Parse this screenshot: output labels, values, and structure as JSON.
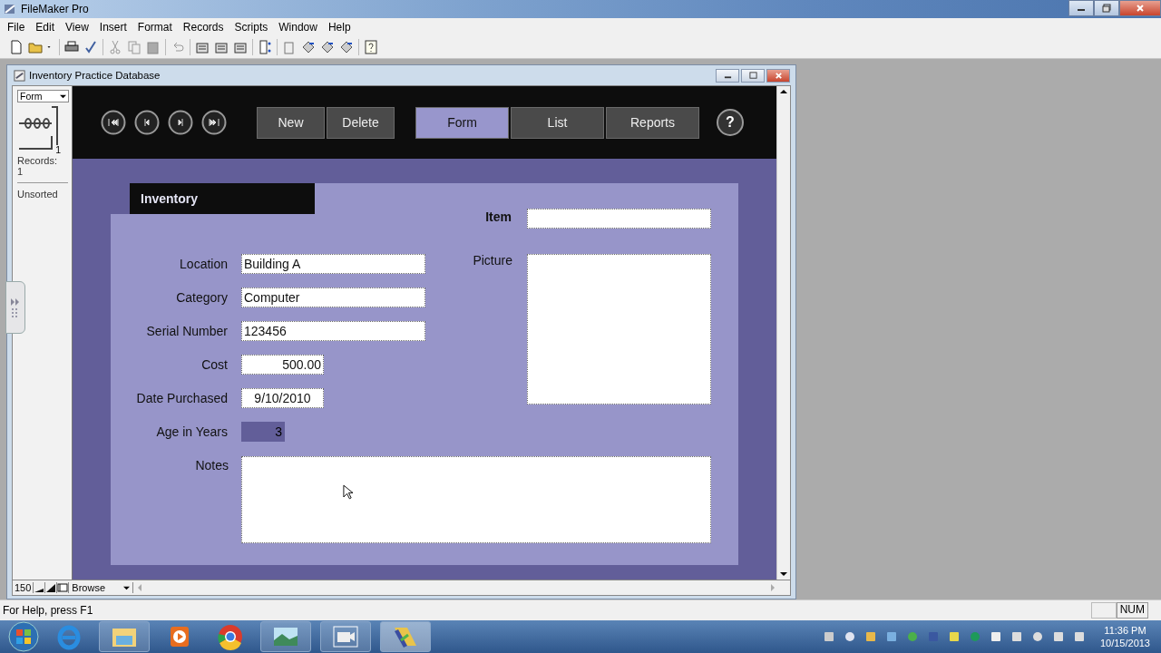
{
  "app": {
    "title": "FileMaker Pro"
  },
  "menu": [
    "File",
    "Edit",
    "View",
    "Insert",
    "Format",
    "Records",
    "Scripts",
    "Window",
    "Help"
  ],
  "window": {
    "title": "Inventory Practice Database"
  },
  "status_area": {
    "layout": "Form",
    "page": "1",
    "records_label": "Records:",
    "records_count": "1",
    "sort_status": "Unsorted"
  },
  "record_buttons": [
    {
      "label": "New"
    },
    {
      "label": "Delete"
    }
  ],
  "view_tabs": [
    {
      "label": "Form",
      "selected": true
    },
    {
      "label": "List",
      "selected": false
    },
    {
      "label": "Reports",
      "selected": false
    }
  ],
  "help_button": "?",
  "form": {
    "tab": "Inventory",
    "item": {
      "label": "Item"
    },
    "picture": {
      "label": "Picture"
    },
    "fields": [
      {
        "label": "Location",
        "value": "Building A",
        "kind": "text"
      },
      {
        "label": "Category",
        "value": "Computer",
        "kind": "text"
      },
      {
        "label": "Serial Number",
        "value": "123456",
        "kind": "text"
      },
      {
        "label": "Cost",
        "value": "500.00",
        "kind": "number"
      },
      {
        "label": "Date Purchased",
        "value": "9/10/2010",
        "kind": "date"
      },
      {
        "label": "Age in Years",
        "value": "3",
        "kind": "calc"
      }
    ],
    "notes": {
      "label": "Notes"
    }
  },
  "bottom_bar": {
    "zoom": "150",
    "mode": "Browse"
  },
  "status_bar": {
    "help": "For Help, press F1",
    "indicator": "NUM"
  },
  "taskbar": {
    "time": "11:36 PM",
    "date": "10/15/2013"
  }
}
